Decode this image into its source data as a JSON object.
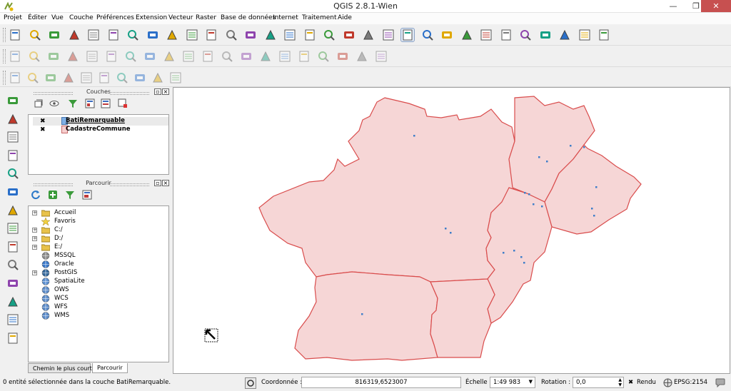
{
  "window": {
    "title": "QGIS 2.8.1-Wien",
    "min": "—",
    "max": "❐",
    "close": "✕"
  },
  "menu": [
    "Projet",
    "Éditer",
    "Vue",
    "Couche",
    "Préférences",
    "Extension",
    "Vecteur",
    "Raster",
    "Base de données",
    "Internet",
    "Traitement",
    "Aide"
  ],
  "toolbar_icons": {
    "row1": [
      "new-project-icon",
      "open-project-icon",
      "save-project-icon",
      "save-as-icon",
      "new-composer-icon",
      "composer-manager-icon",
      "touch-icon",
      "pan-icon",
      "pan-to-selection-icon",
      "zoom-in-icon",
      "zoom-out-icon",
      "zoom-native-icon",
      "zoom-full-icon",
      "zoom-to-selection-icon",
      "zoom-to-layer-icon",
      "zoom-last-icon",
      "zoom-next-icon",
      "refresh-icon",
      "identify-icon",
      "action-icon",
      "select-icon",
      "deselect-icon",
      "field-calculator-icon",
      "attribute-table-icon",
      "statistics-icon",
      "measure-icon",
      "map-tips-icon",
      "annotation-icon",
      "label-icon",
      "help-icon",
      "whats-this-icon"
    ],
    "row2": [
      "current-edits-icon",
      "toggle-edit-icon",
      "save-edits-icon",
      "add-feature-icon",
      "move-feature-icon",
      "node-tool-icon",
      "delete-selected-icon",
      "cut-icon",
      "copy-icon",
      "paste-icon",
      "layer-labeling-icon",
      "label-pin-icon",
      "label-show-hide-icon",
      "label-move-icon",
      "label-rotate-icon",
      "label-change-icon",
      "label-highlight-icon",
      "georef-icon",
      "csw-icon",
      "python-icon"
    ],
    "row3": [
      "digitize-1-icon",
      "digitize-2-icon",
      "digitize-3-icon",
      "digitize-4-icon",
      "digitize-5-icon",
      "digitize-6-icon",
      "digitize-7-icon",
      "digitize-8-icon",
      "digitize-9-icon",
      "digitize-10-icon"
    ]
  },
  "left_toolbar_icons": [
    "add-vector-icon",
    "add-raster-icon",
    "add-postgis-icon",
    "add-spatialite-icon",
    "add-mssql-icon",
    "add-oracle-icon",
    "add-wms-icon",
    "add-wcs-icon",
    "add-wfs-icon",
    "add-delimited-icon",
    "new-layer-icon",
    "add-virtual-icon",
    "gps-icon",
    "overflow-icon"
  ],
  "layers_panel": {
    "title": "Couches",
    "layers": [
      {
        "name": "BatiRemarquable",
        "checked": "✖",
        "color": "#7fb0e6"
      },
      {
        "name": "CadastreCommune",
        "checked": "✖",
        "color": "#f6cfcf"
      }
    ]
  },
  "browser_panel": {
    "title": "Parcourir",
    "items": [
      {
        "label": "Accueil",
        "expandable": true,
        "icon": "folder-icon"
      },
      {
        "label": "Favoris",
        "expandable": false,
        "icon": "star-icon"
      },
      {
        "label": "C:/",
        "expandable": true,
        "icon": "folder-icon"
      },
      {
        "label": "D:/",
        "expandable": true,
        "icon": "folder-icon"
      },
      {
        "label": "E:/",
        "expandable": true,
        "icon": "folder-icon"
      },
      {
        "label": "MSSQL",
        "expandable": false,
        "icon": "mssql-icon"
      },
      {
        "label": "Oracle",
        "expandable": false,
        "icon": "oracle-icon"
      },
      {
        "label": "PostGIS",
        "expandable": true,
        "icon": "postgis-icon"
      },
      {
        "label": "SpatiaLite",
        "expandable": false,
        "icon": "spatialite-icon"
      },
      {
        "label": "OWS",
        "expandable": false,
        "icon": "globe-icon"
      },
      {
        "label": "WCS",
        "expandable": false,
        "icon": "globe-icon"
      },
      {
        "label": "WFS",
        "expandable": false,
        "icon": "wfs-icon"
      },
      {
        "label": "WMS",
        "expandable": false,
        "icon": "globe-icon"
      }
    ]
  },
  "dock_tabs": [
    "Chemin le plus court",
    "Parcourir"
  ],
  "map": {
    "fill_color": "#f6d6d6",
    "outline_color": "#d94c4c",
    "building_color": "#3f7ec9"
  },
  "status": {
    "message": "0 entité sélectionnée dans la couche BatiRemarquable.",
    "coord_label": "Coordonnée :",
    "coord_value": "816319,6523007",
    "scale_label": "Échelle",
    "scale_value": "1:49 983",
    "rotation_label": "Rotation :",
    "rotation_value": "0,0",
    "render_label": "Rendu",
    "crs_label": "EPSG:2154"
  }
}
